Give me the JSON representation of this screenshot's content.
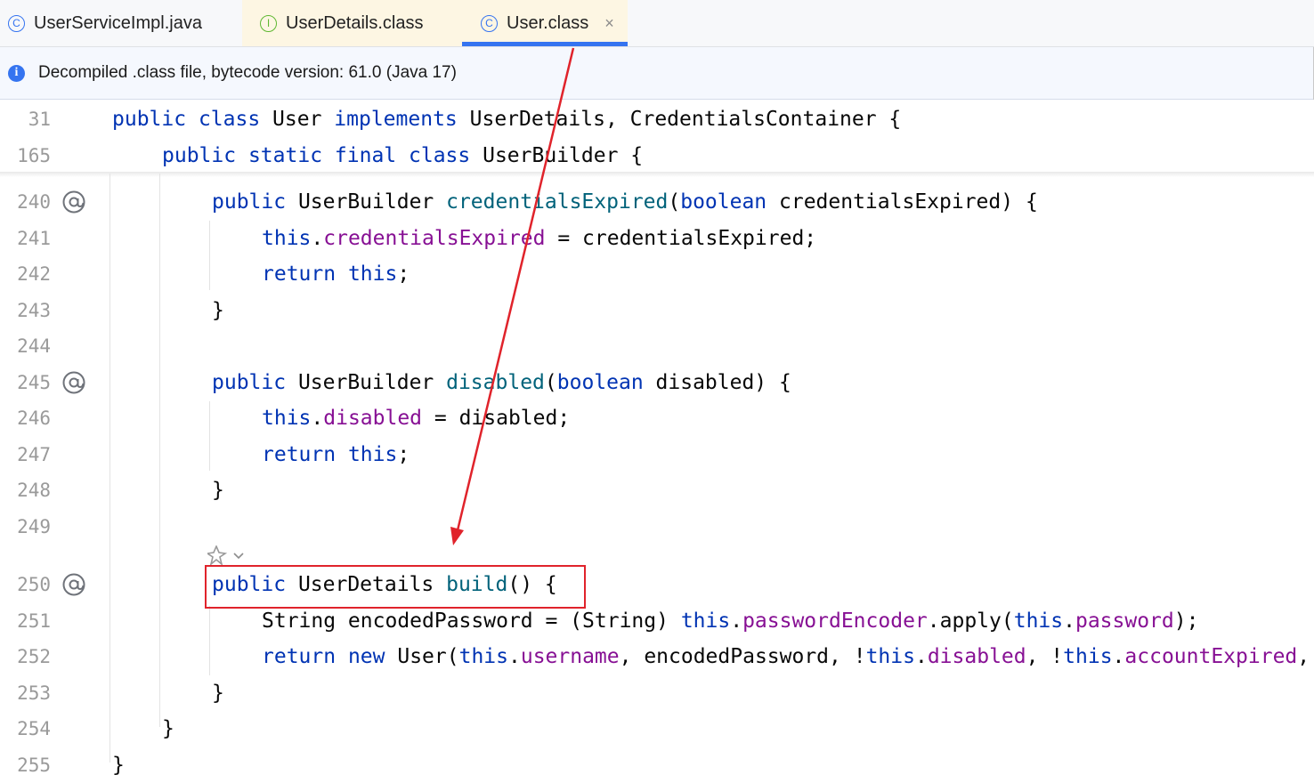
{
  "tabs": [
    {
      "label": "UserServiceImpl.java",
      "icon": "class-icon",
      "icon_glyph": "C",
      "active": false
    },
    {
      "label": "UserDetails.class",
      "icon": "interface-icon",
      "icon_glyph": "I",
      "active": false
    },
    {
      "label": "User.class",
      "icon": "class-icon",
      "icon_glyph": "C",
      "active": true,
      "close_glyph": "×"
    }
  ],
  "banner": {
    "icon": "info-icon",
    "icon_glyph": "i",
    "text": "Decompiled .class file, bytecode version: 61.0 (Java 17)"
  },
  "editor": {
    "sticky_lines": [
      {
        "number": "31",
        "indent": 0,
        "tokens": [
          {
            "t": "public",
            "c": "kw"
          },
          {
            "t": " "
          },
          {
            "t": "class",
            "c": "kw"
          },
          {
            "t": " User "
          },
          {
            "t": "implements",
            "c": "kw"
          },
          {
            "t": " UserDetails, CredentialsContainer {"
          }
        ]
      },
      {
        "number": "165",
        "indent": 1,
        "tokens": [
          {
            "t": "public",
            "c": "kw"
          },
          {
            "t": " "
          },
          {
            "t": "static",
            "c": "kw"
          },
          {
            "t": " "
          },
          {
            "t": "final",
            "c": "kw"
          },
          {
            "t": " "
          },
          {
            "t": "class",
            "c": "kw"
          },
          {
            "t": " UserBuilder {"
          }
        ]
      }
    ],
    "lines": [
      {
        "number": "240",
        "indent": 2,
        "marker": "@",
        "tokens": [
          {
            "t": "public",
            "c": "kw"
          },
          {
            "t": " UserBuilder "
          },
          {
            "t": "credentialsExpired",
            "c": "mth"
          },
          {
            "t": "("
          },
          {
            "t": "boolean",
            "c": "kw"
          },
          {
            "t": " credentialsExpired) {"
          }
        ]
      },
      {
        "number": "241",
        "indent": 3,
        "tokens": [
          {
            "t": "this",
            "c": "kw"
          },
          {
            "t": "."
          },
          {
            "t": "credentialsExpired",
            "c": "fld"
          },
          {
            "t": " = credentialsExpired;"
          }
        ]
      },
      {
        "number": "242",
        "indent": 3,
        "tokens": [
          {
            "t": "return",
            "c": "kw"
          },
          {
            "t": " "
          },
          {
            "t": "this",
            "c": "kw"
          },
          {
            "t": ";"
          }
        ]
      },
      {
        "number": "243",
        "indent": 2,
        "tokens": [
          {
            "t": "}"
          }
        ]
      },
      {
        "number": "244",
        "indent": 0,
        "tokens": []
      },
      {
        "number": "245",
        "indent": 2,
        "marker": "@",
        "tokens": [
          {
            "t": "public",
            "c": "kw"
          },
          {
            "t": " UserBuilder "
          },
          {
            "t": "disabled",
            "c": "mth"
          },
          {
            "t": "("
          },
          {
            "t": "boolean",
            "c": "kw"
          },
          {
            "t": " disabled) {"
          }
        ]
      },
      {
        "number": "246",
        "indent": 3,
        "tokens": [
          {
            "t": "this",
            "c": "kw"
          },
          {
            "t": "."
          },
          {
            "t": "disabled",
            "c": "fld"
          },
          {
            "t": " = disabled;"
          }
        ]
      },
      {
        "number": "247",
        "indent": 3,
        "tokens": [
          {
            "t": "return",
            "c": "kw"
          },
          {
            "t": " "
          },
          {
            "t": "this",
            "c": "kw"
          },
          {
            "t": ";"
          }
        ]
      },
      {
        "number": "248",
        "indent": 2,
        "tokens": [
          {
            "t": "}"
          }
        ]
      },
      {
        "number": "249",
        "indent": 0,
        "tokens": []
      },
      {
        "number": "250",
        "indent": 2,
        "marker": "@",
        "highlighted": true,
        "tokens": [
          {
            "t": "public",
            "c": "kw"
          },
          {
            "t": " UserDetails "
          },
          {
            "t": "build",
            "c": "mth"
          },
          {
            "t": "() {"
          }
        ]
      },
      {
        "number": "251",
        "indent": 3,
        "tokens": [
          {
            "t": "String encodedPassword = (String) "
          },
          {
            "t": "this",
            "c": "kw"
          },
          {
            "t": "."
          },
          {
            "t": "passwordEncoder",
            "c": "fld"
          },
          {
            "t": ".apply("
          },
          {
            "t": "this",
            "c": "kw"
          },
          {
            "t": "."
          },
          {
            "t": "password",
            "c": "fld"
          },
          {
            "t": ");"
          }
        ]
      },
      {
        "number": "252",
        "indent": 3,
        "tokens": [
          {
            "t": "return",
            "c": "kw"
          },
          {
            "t": " "
          },
          {
            "t": "new",
            "c": "kw"
          },
          {
            "t": " User("
          },
          {
            "t": "this",
            "c": "kw"
          },
          {
            "t": "."
          },
          {
            "t": "username",
            "c": "fld"
          },
          {
            "t": ", encodedPassword, !"
          },
          {
            "t": "this",
            "c": "kw"
          },
          {
            "t": "."
          },
          {
            "t": "disabled",
            "c": "fld"
          },
          {
            "t": ", !"
          },
          {
            "t": "this",
            "c": "kw"
          },
          {
            "t": "."
          },
          {
            "t": "accountExpired",
            "c": "fld"
          },
          {
            "t": ","
          }
        ]
      },
      {
        "number": "253",
        "indent": 2,
        "tokens": [
          {
            "t": "}"
          }
        ]
      },
      {
        "number": "254",
        "indent": 1,
        "tokens": [
          {
            "t": "}"
          }
        ]
      },
      {
        "number": "255",
        "indent": 0,
        "tokens": [
          {
            "t": "}"
          }
        ]
      }
    ]
  },
  "annotation": {
    "type": "red-arrow",
    "from": "tab-user-class",
    "to": "build-method-box"
  },
  "colors": {
    "keyword": "#0033b3",
    "field": "#871094",
    "method": "#00627a",
    "accent": "#3574f0",
    "annotation": "#e0232b"
  }
}
